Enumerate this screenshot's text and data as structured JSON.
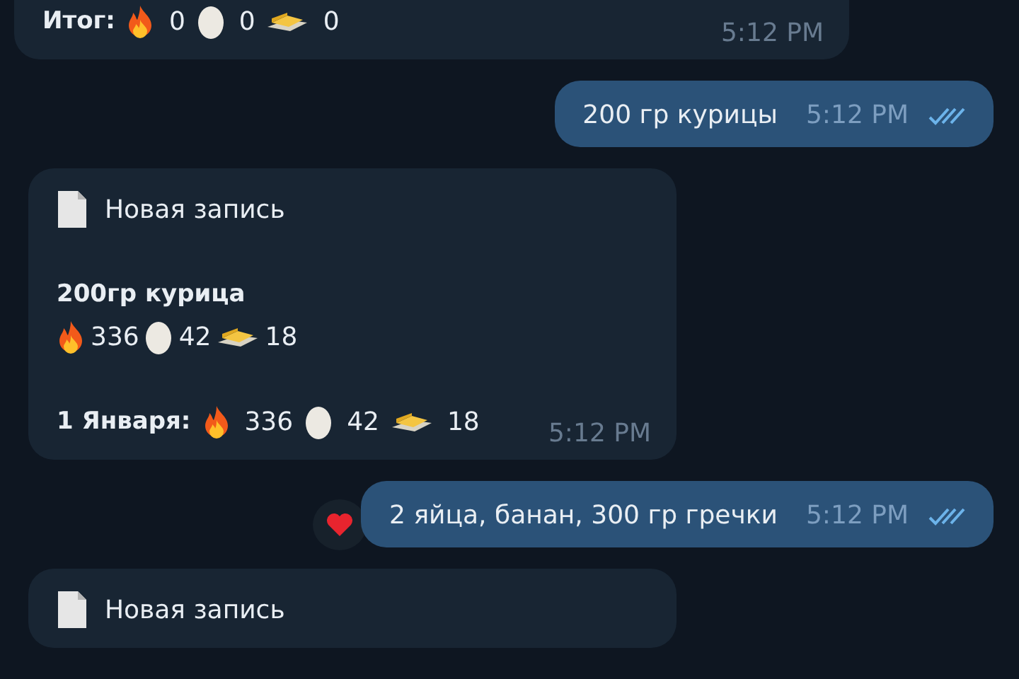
{
  "messages": [
    {
      "kind": "incoming",
      "lines": [
        {
          "kind": "total",
          "label": "Итог:",
          "stats": [
            {
              "kind": "fire",
              "value": "0"
            },
            {
              "kind": "egg",
              "value": "0"
            },
            {
              "kind": "butter",
              "value": "0"
            }
          ]
        }
      ],
      "time": "5:12 PM"
    },
    {
      "kind": "outgoing",
      "text": "200 гр курицы",
      "time": "5:12 PM",
      "read": true
    },
    {
      "kind": "incoming",
      "lines": [
        {
          "kind": "header",
          "text": "Новая запись"
        },
        {
          "kind": "blank"
        },
        {
          "kind": "title",
          "text": "200гр курица"
        },
        {
          "kind": "stats",
          "stats": [
            {
              "kind": "fire",
              "value": "336"
            },
            {
              "kind": "egg",
              "value": "42"
            },
            {
              "kind": "butter",
              "value": "18"
            }
          ]
        },
        {
          "kind": "blank"
        },
        {
          "kind": "total",
          "label": "1 Января:",
          "stats": [
            {
              "kind": "fire",
              "value": "336"
            },
            {
              "kind": "egg",
              "value": "42"
            },
            {
              "kind": "butter",
              "value": "18"
            }
          ]
        }
      ],
      "time": "5:12 PM"
    },
    {
      "kind": "outgoing",
      "text": "2 яйца, банан, 300 гр гречки",
      "time": "5:12 PM",
      "read": true,
      "heart_reaction": true
    },
    {
      "kind": "incoming",
      "lines": [
        {
          "kind": "header",
          "text": "Новая запись"
        }
      ]
    }
  ]
}
